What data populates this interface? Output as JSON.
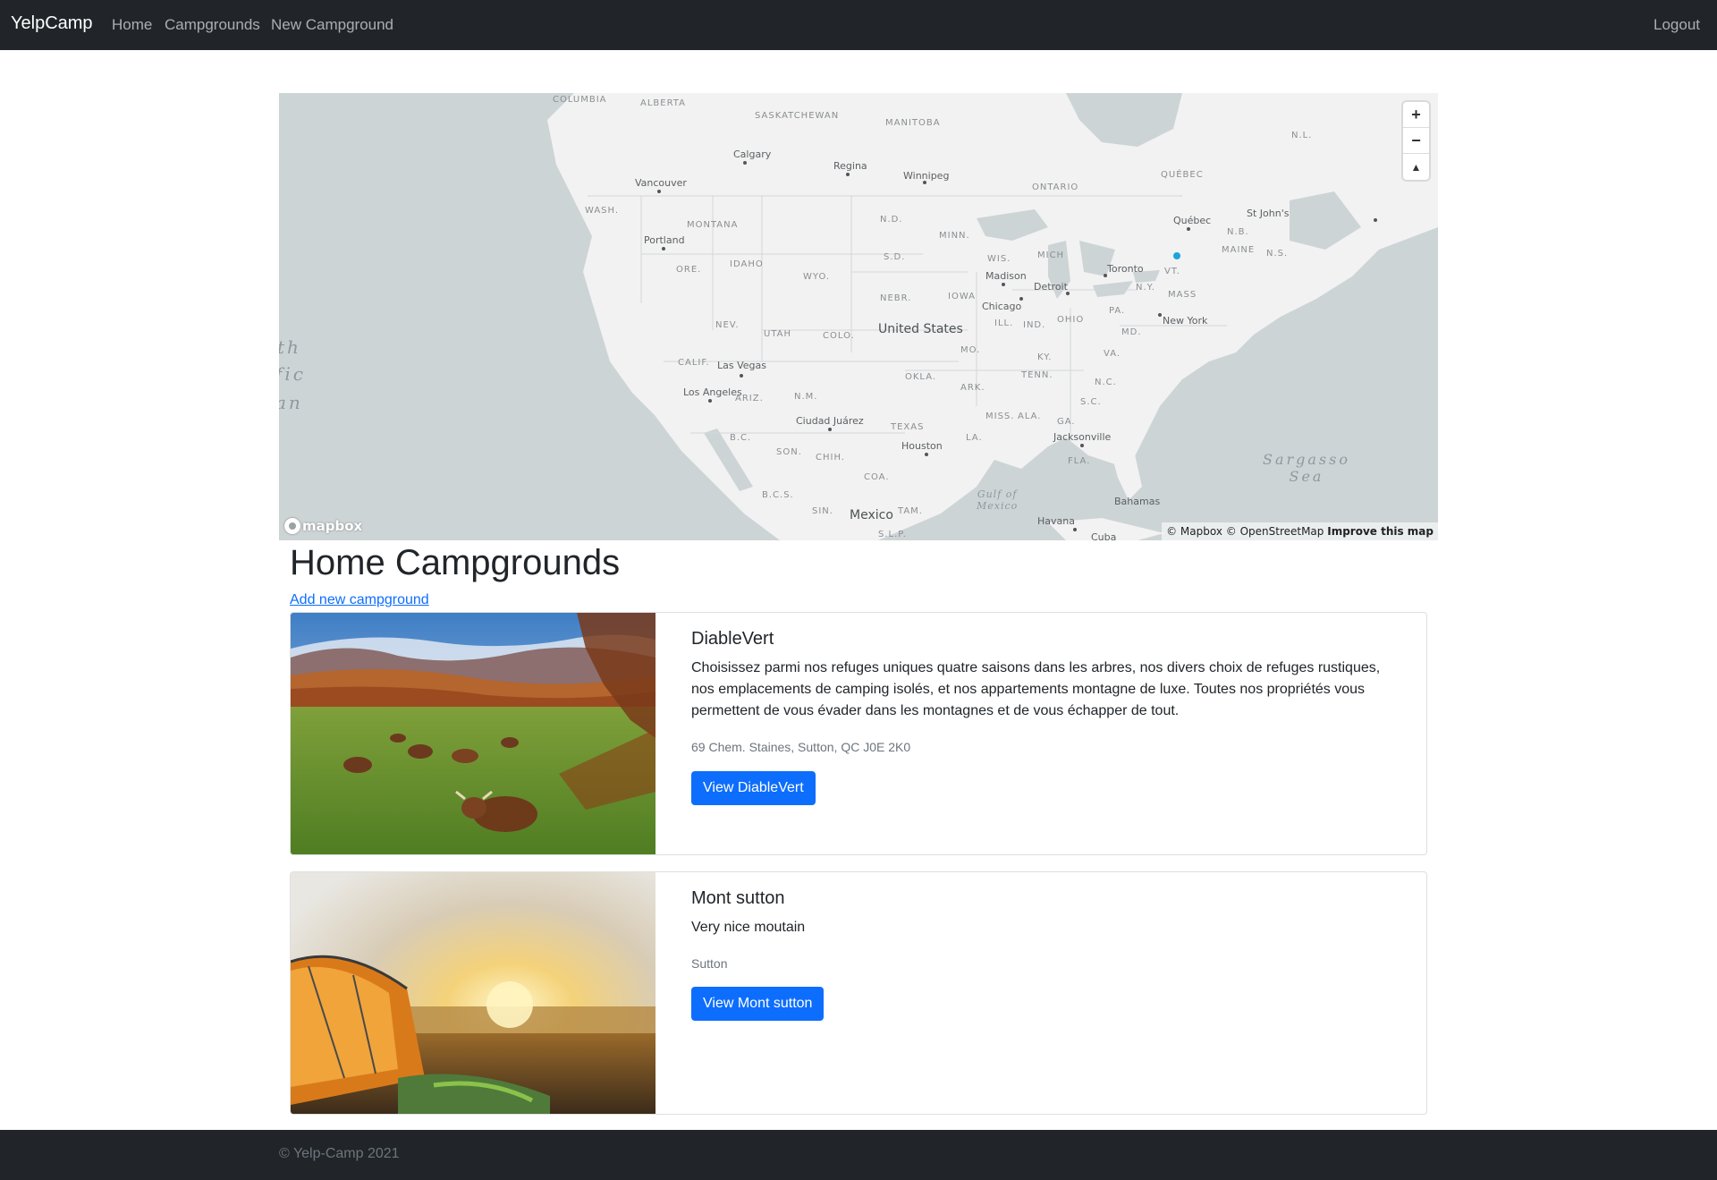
{
  "navbar": {
    "brand": "YelpCamp",
    "links": [
      "Home",
      "Campgrounds",
      "New Campground"
    ],
    "logout": "Logout"
  },
  "map": {
    "zoom_in": "+",
    "zoom_out": "−",
    "compass": "▲",
    "logo": "mapbox",
    "attribution": "© Mapbox © OpenStreetMap",
    "improve": "Improve this map",
    "country_labels": [
      "United States",
      "Mexico"
    ],
    "region_labels": [
      "COLUMBIA",
      "ALBERTA",
      "SASKATCHEWAN",
      "MANITOBA",
      "ONTARIO",
      "QUÉBEC",
      "N.L.",
      "WASH.",
      "MONTANA",
      "N.D.",
      "MINN.",
      "ORE.",
      "IDAHO",
      "WYO.",
      "S.D.",
      "WIS.",
      "MICH",
      "MAINE",
      "N.B.",
      "N.S.",
      "NEBR.",
      "IOWA",
      "N.Y.",
      "MASS",
      "NEV.",
      "UTAH",
      "COLO.",
      "ILL.",
      "IND.",
      "OHIO",
      "PA.",
      "CALIF.",
      "MO.",
      "KY.",
      "VA.",
      "OKLA.",
      "TENN.",
      "ARIZ.",
      "N.M.",
      "ARK.",
      "N.C.",
      "S.C.",
      "MISS.",
      "ALA.",
      "GA.",
      "TEXAS",
      "LA.",
      "FLA.",
      "B.C.",
      "SON.",
      "CHIH.",
      "COA.",
      "B.C.S.",
      "SIN.",
      "TAM.",
      "S.L.P.",
      "VT.",
      "MD."
    ],
    "city_labels": [
      "Calgary",
      "Regina",
      "Winnipeg",
      "Vancouver",
      "Portland",
      "Québec",
      "St John's",
      "Toronto",
      "Madison",
      "Detroit",
      "Chicago",
      "New York",
      "Las Vegas",
      "Los Angeles",
      "Ciudad Juárez",
      "Houston",
      "Jacksonville",
      "Bahamas",
      "Havana",
      "Cuba"
    ],
    "sea_labels": [
      "Sargasso\nSea",
      "Gulf of\nMexico"
    ],
    "edge_text": [
      "th",
      "fic",
      "an"
    ]
  },
  "page": {
    "title": "Home Campgrounds",
    "add_link": "Add new campground"
  },
  "campgrounds": [
    {
      "title": "DiableVert",
      "description": "Choisissez parmi nos refuges uniques quatre saisons dans les arbres, nos divers choix de refuges rustiques, nos emplacements de camping isolés, et nos appartements montagne de luxe. Toutes nos propriétés vous permettent de vous évader dans les montagnes et de vous échapper de tout.",
      "location": "69 Chem. Staines, Sutton, QC J0E 2K0",
      "button": "View DiableVert"
    },
    {
      "title": "Mont sutton",
      "description": "Very nice moutain",
      "location": "Sutton",
      "button": "View Mont sutton"
    }
  ],
  "footer": {
    "text": "© Yelp-Camp 2021"
  },
  "colors": {
    "navbar_bg": "#212529",
    "primary": "#0d6efd",
    "muted": "#6c757d",
    "map_water": "#cdd4d6",
    "map_land": "#f2f2f2",
    "map_pin": "#1aa5db"
  }
}
